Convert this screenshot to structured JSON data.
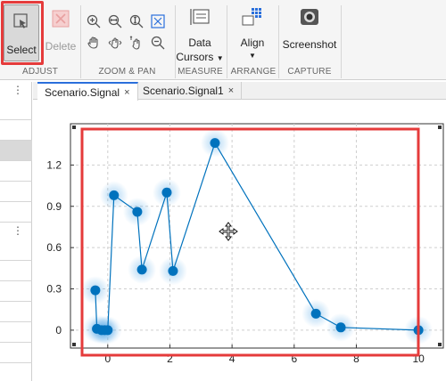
{
  "toolstrip": {
    "select_label": "Select",
    "delete_label": "Delete",
    "data_cursors_line1": "Data",
    "data_cursors_line2": "Cursors",
    "align_label": "Align",
    "screenshot_label": "Screenshot",
    "groups": {
      "adjust": "ADJUST",
      "zoom_pan": "ZOOM & PAN",
      "measure": "MEASURE",
      "arrange": "ARRANGE",
      "capture": "CAPTURE"
    },
    "accent_highlight": "#e53b3b"
  },
  "tabs": [
    {
      "label": "Scenario.Signal",
      "close": "×",
      "active": true
    },
    {
      "label": "Scenario.Signal1",
      "close": "×",
      "active": false
    }
  ],
  "left_panel": {
    "menu_glyph": "⋮"
  },
  "chart_data": {
    "type": "line",
    "series": [
      {
        "color": "#0072bd",
        "x": [
          -0.4,
          -0.35,
          -0.2,
          -0.1,
          0.0,
          0.2,
          0.95,
          1.1,
          1.9,
          2.1,
          3.45,
          6.7,
          7.5,
          10.0
        ],
        "y": [
          0.29,
          0.01,
          0.0,
          0.0,
          0.0,
          0.98,
          0.86,
          0.44,
          1.0,
          0.43,
          1.36,
          0.12,
          0.02,
          0.0
        ]
      }
    ],
    "xlim": [
      -1.2,
      10.8
    ],
    "ylim": [
      -0.13,
      1.5
    ],
    "xticks": [
      "0",
      "2",
      "4",
      "6",
      "8",
      "10"
    ],
    "yticks": [
      "0",
      "0.3",
      "0.6",
      "0.9",
      "1.2"
    ],
    "grid": true,
    "selection_highlight_color": "#e53b3b"
  }
}
